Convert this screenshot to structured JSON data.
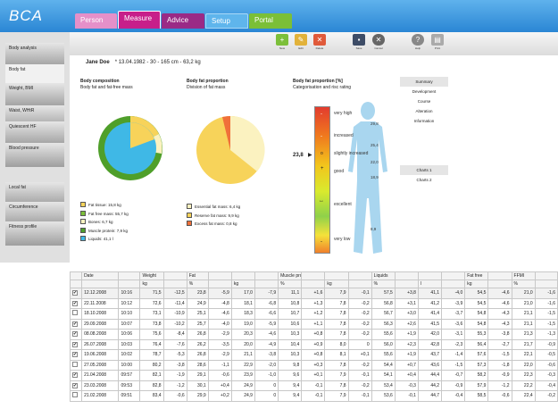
{
  "app": {
    "logo": "BCA"
  },
  "tabs": [
    "Person",
    "Measure",
    "Advice",
    "Setup",
    "Portal"
  ],
  "sidebar": [
    "Body analysis",
    "Body fat",
    "Weight, BMI",
    "Waist, WHtR",
    "Quiescent HF",
    "Blood pressure",
    "Local fat",
    "Circumference",
    "Fitness profile"
  ],
  "toolbar": {
    "new": "New",
    "edit": "Edit",
    "delete": "Delete",
    "save": "Save",
    "cancel": "Cancel",
    "help": "Help",
    "print": "Print"
  },
  "patient": {
    "name": "Jane Doe",
    "details": "* 13.04.1982  -  30  -  165 cm  -  63,2 kg"
  },
  "panels": {
    "comp": {
      "title": "Body composition",
      "subtitle": "Body fat and fat-free mass",
      "legend": [
        "Fat tissue: 15,8 kg",
        "Fat free mass: 55,7 kg",
        "Bones: 6,7 kg",
        "Muscle protein: 7,9 kg",
        "Liquids: 41,1 l"
      ]
    },
    "fat": {
      "title": "Body fat proportion",
      "subtitle": "Division of fat mass",
      "legend": [
        "Essential fat mass: 6,4 kg",
        "Reserve fat mass: 9,9 kg",
        "Excess fat mass: 0,8 kg"
      ]
    },
    "rating": {
      "title": "Body fat proportion [%]",
      "subtitle": "Categorisation and risc rating",
      "value": "23,8",
      "labels": [
        "very high",
        "increased",
        "slightly increased",
        "good",
        "excellent",
        "very low"
      ],
      "ticks": [
        "29,8",
        "25,4",
        "22,0",
        "18,9",
        "8,9"
      ]
    }
  },
  "colors": {
    "fat": "#f7d35a",
    "fatfree": "#3fb8e6",
    "bones": "#fbf2c0",
    "muscle": "#4f9f2a",
    "liquids": "#3fb8e6",
    "essential": "#fbf2c0",
    "reserve": "#f7d35a",
    "excess": "#f0703a"
  },
  "links": [
    "Summary",
    "Development",
    "Course",
    "Alteration",
    "Information",
    "",
    "",
    "",
    "",
    "Charts 1",
    "Charts 2"
  ],
  "table": {
    "groups": [
      "",
      "Date",
      "",
      "Weight",
      "",
      "Fat",
      "",
      "",
      "",
      "Muscle protein",
      "",
      "",
      "",
      "Liquids",
      "",
      "",
      "",
      "Fat free",
      "",
      "FFMI",
      ""
    ],
    "units": [
      "",
      "",
      "",
      "kg",
      "",
      "%",
      "",
      "kg",
      "",
      "%",
      "",
      "kg",
      "",
      "%",
      "",
      "l",
      "",
      "kg",
      "",
      "%",
      ""
    ],
    "rows": [
      [
        "12.12.2008",
        "10:16",
        "71,5",
        "-12,5",
        "23,8",
        "-5,9",
        "17,0",
        "-7,9",
        "11,1",
        "+1,6",
        "7,9",
        "-0,1",
        "57,5",
        "+3,8",
        "41,1",
        "-4,0",
        "54,5",
        "-4,6",
        "21,0",
        "-1,6"
      ],
      [
        "22.11.2008",
        "10:12",
        "72,6",
        "-11,4",
        "24,9",
        "-4,8",
        "18,1",
        "-6,8",
        "10,8",
        "+1,3",
        "7,8",
        "-0,2",
        "56,8",
        "+3,1",
        "41,2",
        "-3,9",
        "54,5",
        "-4,6",
        "21,0",
        "-1,6"
      ],
      [
        "18.10.2008",
        "10:10",
        "73,1",
        "-10,9",
        "25,1",
        "-4,6",
        "18,3",
        "-6,6",
        "10,7",
        "+1,2",
        "7,8",
        "-0,2",
        "56,7",
        "+3,0",
        "41,4",
        "-3,7",
        "54,8",
        "-4,3",
        "21,1",
        "-1,5"
      ],
      [
        "29.09.2008",
        "10:07",
        "73,8",
        "-10,2",
        "25,7",
        "-4,0",
        "19,0",
        "-5,9",
        "10,6",
        "+1,1",
        "7,8",
        "-0,2",
        "56,3",
        "+2,6",
        "41,5",
        "-3,6",
        "54,8",
        "-4,3",
        "21,1",
        "-1,5"
      ],
      [
        "08.08.2008",
        "10:06",
        "75,6",
        "-8,4",
        "26,8",
        "-2,9",
        "20,3",
        "-4,6",
        "10,3",
        "+0,8",
        "7,8",
        "-0,2",
        "55,6",
        "+1,9",
        "42,0",
        "-3,1",
        "55,3",
        "-3,8",
        "21,3",
        "-1,3"
      ],
      [
        "26.07.2008",
        "10:03",
        "76,4",
        "-7,6",
        "26,2",
        "-3,5",
        "20,0",
        "-4,9",
        "10,4",
        "+0,9",
        "8,0",
        "0",
        "56,0",
        "+2,3",
        "42,8",
        "-2,3",
        "56,4",
        "-2,7",
        "21,7",
        "-0,9"
      ],
      [
        "19.06.2008",
        "10:02",
        "78,7",
        "-5,3",
        "26,8",
        "-2,9",
        "21,1",
        "-3,8",
        "10,3",
        "+0,8",
        "8,1",
        "+0,1",
        "55,6",
        "+1,9",
        "43,7",
        "-1,4",
        "57,6",
        "-1,5",
        "22,1",
        "-0,5"
      ],
      [
        "27.05.2008",
        "10:00",
        "80,2",
        "-3,8",
        "28,6",
        "-1,1",
        "22,9",
        "-2,0",
        "9,8",
        "+0,3",
        "7,8",
        "-0,2",
        "54,4",
        "+0,7",
        "43,6",
        "-1,5",
        "57,3",
        "-1,8",
        "22,0",
        "-0,6"
      ],
      [
        "21.04.2008",
        "09:57",
        "82,1",
        "-1,9",
        "29,1",
        "-0,6",
        "23,9",
        "-1,0",
        "9,6",
        "+0,1",
        "7,9",
        "-0,1",
        "54,1",
        "+0,4",
        "44,4",
        "-0,7",
        "58,2",
        "-0,9",
        "22,3",
        "-0,3"
      ],
      [
        "23.03.2008",
        "09:53",
        "82,8",
        "-1,2",
        "30,1",
        "+0,4",
        "24,9",
        "0",
        "9,4",
        "-0,1",
        "7,8",
        "-0,2",
        "53,4",
        "-0,3",
        "44,2",
        "-0,9",
        "57,9",
        "-1,2",
        "22,2",
        "-0,4"
      ],
      [
        "21.02.2008",
        "09:51",
        "83,4",
        "-0,6",
        "29,9",
        "+0,2",
        "24,9",
        "0",
        "9,4",
        "-0,1",
        "7,9",
        "-0,1",
        "53,6",
        "-0,1",
        "44,7",
        "-0,4",
        "58,5",
        "-0,6",
        "22,4",
        "-0,2"
      ]
    ],
    "checked": [
      true,
      true,
      false,
      true,
      true,
      true,
      true,
      false,
      true,
      true,
      false
    ]
  }
}
